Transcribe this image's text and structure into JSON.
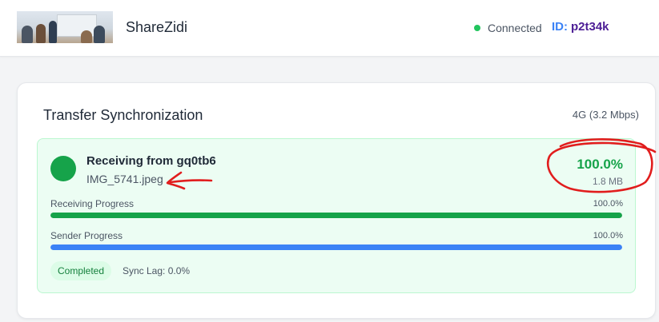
{
  "header": {
    "app_name": "ShareZidi",
    "status_text": "Connected",
    "id_label": "ID:",
    "id_value": "p2t34k"
  },
  "card": {
    "title": "Transfer Synchronization",
    "network": "4G (3.2 Mbps)"
  },
  "transfer": {
    "title": "Receiving from gq0tb6",
    "file_name": "IMG_5741.jpeg",
    "percent": "100.0%",
    "size": "1.8 MB",
    "receiving": {
      "label": "Receiving Progress",
      "value": "100.0%",
      "fraction": 1.0
    },
    "sender": {
      "label": "Sender Progress",
      "value": "100.0%",
      "fraction": 1.0
    },
    "status_badge": "Completed",
    "sync_lag": "Sync Lag: 0.0%"
  },
  "colors": {
    "accent_green": "#16a34a",
    "accent_blue": "#3b82f6",
    "status_dot": "#22c55e",
    "id_value": "#4c1d95",
    "annotation_red": "#e11d1d"
  },
  "icons": {
    "status": "status-dot-icon",
    "peer": "peer-avatar-icon"
  }
}
